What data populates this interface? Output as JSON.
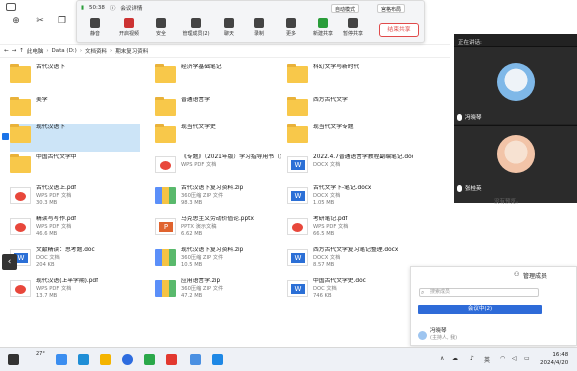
{
  "addressbar": {
    "crumbs": [
      "此电脑",
      "Data (D:)",
      "文档资料",
      "期末复习资料"
    ]
  },
  "files": [
    {
      "name": "古代汉语下",
      "type": "folder",
      "sub1": "",
      "sub2": ""
    },
    {
      "name": "经济学基础笔记",
      "type": "folder",
      "sub1": "",
      "sub2": ""
    },
    {
      "name": "科幻文学与新时代",
      "type": "folder",
      "sub1": "",
      "sub2": ""
    },
    {
      "name": "美学",
      "type": "folder",
      "sub1": "",
      "sub2": ""
    },
    {
      "name": "普通语言学",
      "type": "folder",
      "sub1": "",
      "sub2": ""
    },
    {
      "name": "西方古代文学",
      "type": "folder",
      "sub1": "",
      "sub2": ""
    },
    {
      "name": "现代汉语下",
      "type": "folder",
      "sub1": "",
      "sub2": "",
      "selected": true
    },
    {
      "name": "现当代文学史",
      "type": "folder",
      "sub1": "",
      "sub2": ""
    },
    {
      "name": "现当代文学专题",
      "type": "folder",
      "sub1": "",
      "sub2": ""
    },
    {
      "name": "中国古代文学中",
      "type": "folder",
      "sub1": "",
      "sub2": ""
    },
    {
      "name": "《专题》（2021年版）学习指导用书（含考研真题）详解...",
      "type": "pdf",
      "sub1": "WPS PDF 文档",
      "sub2": ""
    },
    {
      "name": "2022.4.7普通语言学教程副编笔记.docx",
      "type": "docx",
      "sub1": "DOCX 文档",
      "sub2": ""
    },
    {
      "name": "古代汉语上.pdf",
      "type": "pdf",
      "sub1": "WPS PDF 文档",
      "sub2": "30.3 MB"
    },
    {
      "name": "古代汉语下复习资料.zip",
      "type": "zip",
      "sub1": "360压缩 ZIP 文件",
      "sub2": "98.3 MB"
    },
    {
      "name": "古代文学下-笔记.docx",
      "type": "docx",
      "sub1": "DOCX 文档",
      "sub2": "1.05 MB"
    },
    {
      "name": "精读与写作.pdf",
      "type": "pdf",
      "sub1": "WPS PDF 文档",
      "sub2": "46.6 MB"
    },
    {
      "name": "马克思主义劳动价值论.pptx",
      "type": "pptx",
      "sub1": "PPTX 演示文稿",
      "sub2": "6.62 MB"
    },
    {
      "name": "考研笔记.pdf",
      "type": "pdf",
      "sub1": "WPS PDF 文档",
      "sub2": "66.5 MB"
    },
    {
      "name": "文献精读：思考题.doc",
      "type": "docx",
      "sub1": "DOC 文档",
      "sub2": "204 KB"
    },
    {
      "name": "现代汉语下复习资料.zip",
      "type": "zip",
      "sub1": "360压缩 ZIP 文件",
      "sub2": "10.5 MB"
    },
    {
      "name": "西方古代文学复习笔记整理.docx",
      "type": "docx",
      "sub1": "DOCX 文档",
      "sub2": "8.57 MB"
    },
    {
      "name": "现代汉语(上半学期).pdf",
      "type": "pdf",
      "sub1": "WPS PDF 文档",
      "sub2": "13.7 MB"
    },
    {
      "name": "应用语言学.zip",
      "type": "zip",
      "sub1": "360压缩 ZIP 文件",
      "sub2": "47.2 MB"
    },
    {
      "name": "中国古代文学史.doc",
      "type": "docx",
      "sub1": "DOC 文档",
      "sub2": "746 KB"
    }
  ],
  "meeting": {
    "time": "50:38",
    "info_label": "会议详情",
    "view_select": "自动模式",
    "layout_select": "宫格布局",
    "buttons": [
      "静音",
      "开启视频",
      "安全",
      "管理成员(2)",
      "聊天",
      "录制",
      "更多",
      "新建共享",
      "暂停共享"
    ],
    "end_label": "结束共享"
  },
  "video": {
    "header": "正在讲话:",
    "user1": "冯晓琴",
    "user2": "张桂英",
    "nocontent": "没有预览。"
  },
  "participants": {
    "title": "管理成员",
    "search_placeholder": "搜索成员",
    "tab": "会议中(2)",
    "user_name": "冯晓琴",
    "user_role": "(主持人, 我)"
  },
  "taskbar": {
    "weather": "27°",
    "lang": "英",
    "time": "16:48",
    "date": "2024/4/20"
  }
}
